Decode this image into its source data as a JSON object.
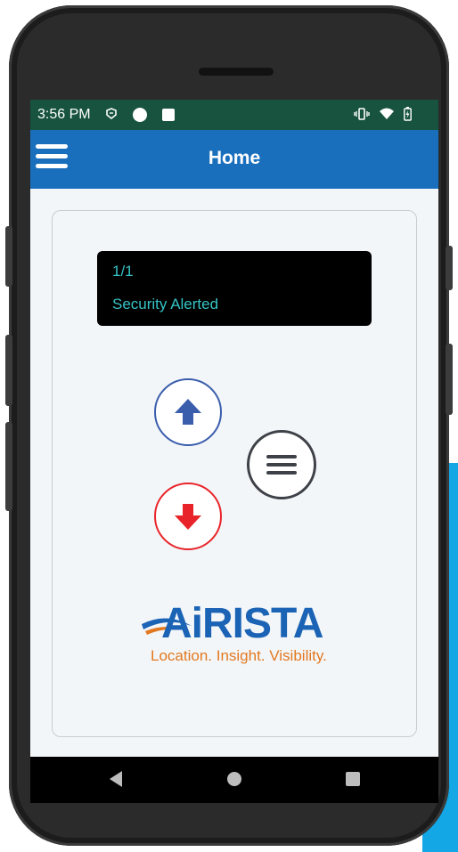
{
  "status_bar": {
    "time": "3:56 PM",
    "left_icons": [
      "sim-icon",
      "circle-icon",
      "square-icon"
    ],
    "right_icons": [
      "vibrate-icon",
      "wifi-icon",
      "battery-icon"
    ]
  },
  "app_bar": {
    "title": "Home",
    "menu_icon": "hamburger-menu-icon"
  },
  "display": {
    "counter": "1/1",
    "message": "Security Alerted"
  },
  "controls": {
    "up": "arrow-up-icon",
    "down": "arrow-down-icon",
    "menu": "list-icon"
  },
  "logo": {
    "brand": "AiRISTA",
    "tagline": "Location. Insight. Visibility."
  },
  "nav_bar": [
    "back-icon",
    "home-icon",
    "recents-icon"
  ],
  "colors": {
    "status_bar": "#17533f",
    "app_bar": "#1a6fbd",
    "display_text": "#36c3c6",
    "up_button": "#3a5dac",
    "down_button": "#e8242a",
    "menu_button": "#3e4248",
    "tagline": "#e2781f"
  }
}
